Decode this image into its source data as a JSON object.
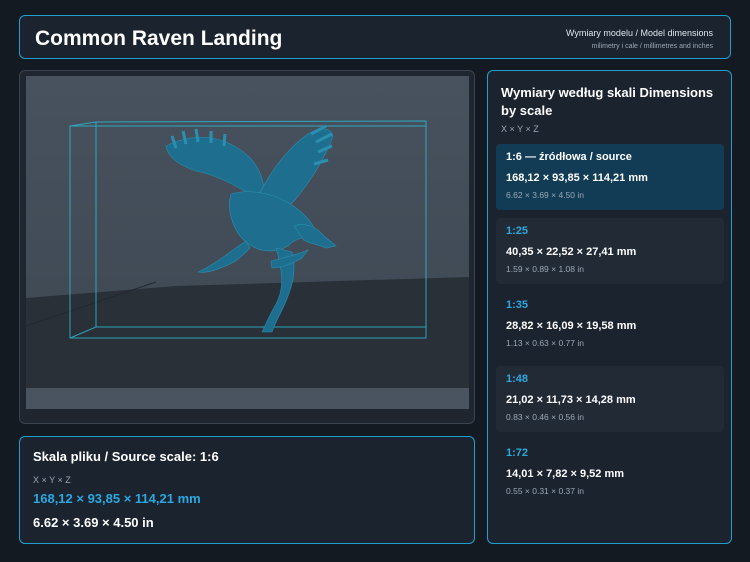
{
  "header": {
    "title": "Common Raven Landing",
    "subtitle": "Wymiary modelu / Model dimensions",
    "subtitle2": "milimetry i cale / millimetres and inches"
  },
  "colors": {
    "accent": "#1f9fcf",
    "highlight": "#2ba8e0",
    "model": "#1e6f8f",
    "active_card": "#123c55"
  },
  "viewer": {
    "model_icon": "raven-model-icon",
    "bounding_box": true
  },
  "source": {
    "heading": "Skala pliku / Source scale: 1:6",
    "axes": "X × Y × Z",
    "mm": "168,12 × 93,85 × 114,21 mm",
    "inch": "6.62 × 3.69 × 4.50 in"
  },
  "scales": {
    "heading": "Wymiary według skali Dimensions by scale",
    "axes": "X × Y × Z",
    "items": [
      {
        "ratio": "1:6  —  źródłowa / source",
        "mm": "168,12 × 93,85 × 114,21 mm",
        "inch": "6.62 × 3.69 × 4.50 in"
      },
      {
        "ratio": "1:25",
        "mm": "40,35 × 22,52 × 27,41 mm",
        "inch": "1.59 × 0.89 × 1.08 in"
      },
      {
        "ratio": "1:35",
        "mm": "28,82 × 16,09 × 19,58 mm",
        "inch": "1.13 × 0.63 × 0.77 in"
      },
      {
        "ratio": "1:48",
        "mm": "21,02 × 11,73 × 14,28 mm",
        "inch": "0.83 × 0.46 × 0.56 in"
      },
      {
        "ratio": "1:72",
        "mm": "14,01 × 7,82 × 9,52 mm",
        "inch": "0.55 × 0.31 × 0.37 in"
      }
    ]
  }
}
